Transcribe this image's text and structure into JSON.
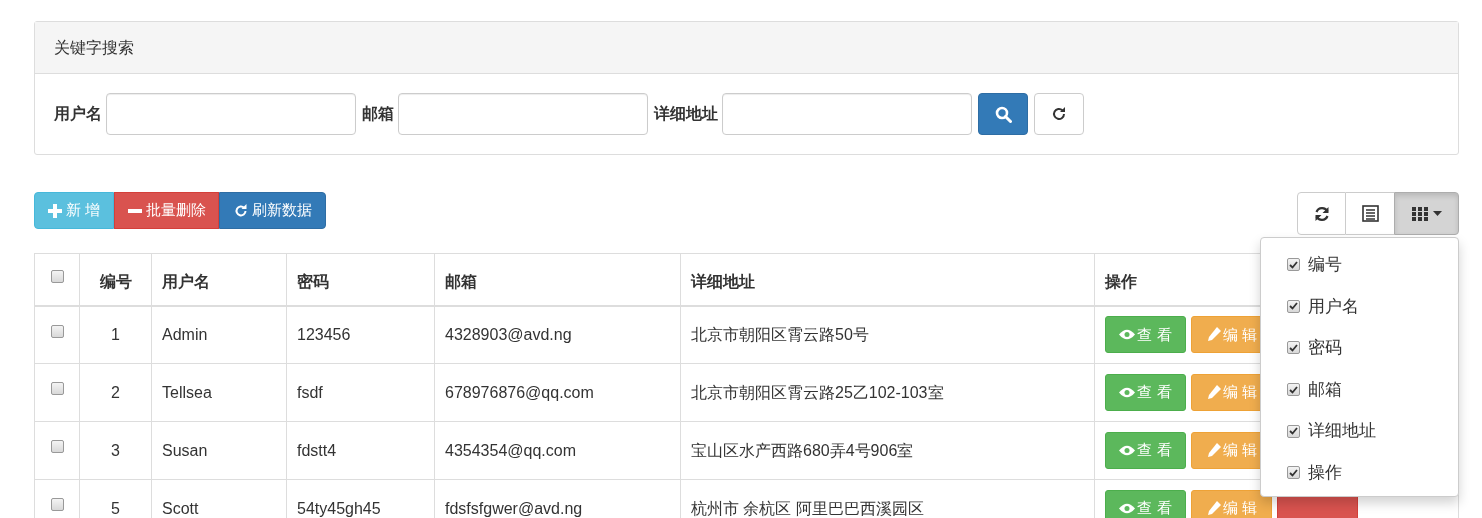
{
  "search_panel": {
    "title": "关键字搜索",
    "fields": [
      {
        "label": "用户名"
      },
      {
        "label": "邮箱"
      },
      {
        "label": "详细地址"
      }
    ]
  },
  "toolbar": {
    "buttons": [
      {
        "kind": "add",
        "label": "新 增"
      },
      {
        "kind": "batch_delete",
        "label": "批量删除"
      },
      {
        "kind": "refresh",
        "label": "刷新数据"
      }
    ]
  },
  "table": {
    "select_all_checked": false,
    "columns": [
      "编号",
      "用户名",
      "密码",
      "邮箱",
      "详细地址",
      "操作"
    ],
    "rows": [
      {
        "checked": false,
        "cells": [
          "1",
          "Admin",
          "123456",
          "4328903@avd.ng",
          "北京市朝阳区霄云路50号"
        ],
        "actions": [
          {
            "kind": "view",
            "label": "查 看"
          },
          {
            "kind": "edit",
            "label": "编 辑"
          }
        ]
      },
      {
        "checked": false,
        "cells": [
          "2",
          "Tellsea",
          "fsdf",
          "678976876@qq.com",
          "北京市朝阳区霄云路25乙102-103室"
        ],
        "actions": [
          {
            "kind": "view",
            "label": "查 看"
          },
          {
            "kind": "edit",
            "label": "编 辑"
          }
        ]
      },
      {
        "checked": false,
        "cells": [
          "3",
          "Susan",
          "fdstt4",
          "4354354@qq.com",
          "宝山区水产西路680弄4号906室"
        ],
        "actions": [
          {
            "kind": "view",
            "label": "查 看"
          },
          {
            "kind": "edit",
            "label": "编 辑"
          }
        ]
      },
      {
        "checked": false,
        "cells": [
          "5",
          "Scott",
          "54ty45gh45",
          "fdsfsfgwer@avd.ng",
          "杭州市 余杭区 阿里巴巴西溪园区"
        ],
        "actions": [
          {
            "kind": "view",
            "label": "查 看"
          },
          {
            "kind": "edit",
            "label": "编 辑"
          },
          {
            "kind": "delete"
          }
        ]
      }
    ]
  },
  "column_menu": {
    "expanded": true,
    "items": [
      {
        "label": "编号",
        "checked": true
      },
      {
        "label": "用户名",
        "checked": true
      },
      {
        "label": "密码",
        "checked": true
      },
      {
        "label": "邮箱",
        "checked": true
      },
      {
        "label": "详细地址",
        "checked": true
      },
      {
        "label": "操作",
        "checked": true
      }
    ]
  }
}
